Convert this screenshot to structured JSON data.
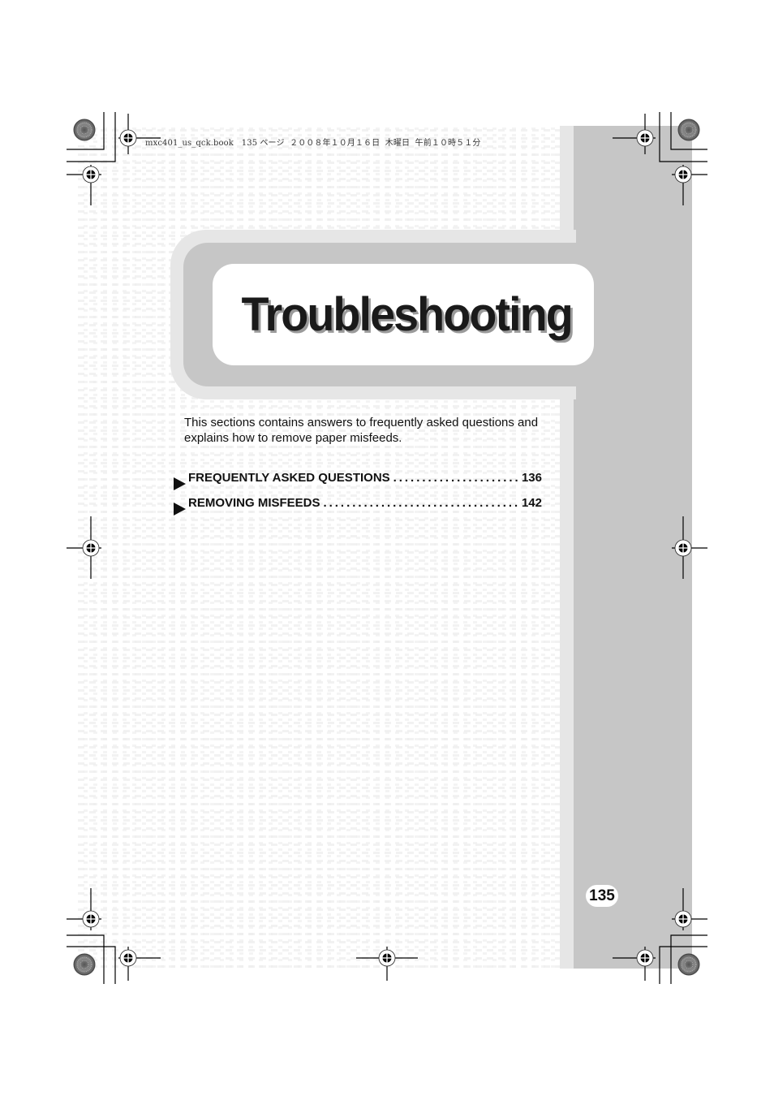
{
  "print_header": {
    "file_name": "mxc401_us_qck.book",
    "page_ref": "135 ページ",
    "date": "２００８年１０月１６日",
    "weekday": "木曜日",
    "time": "午前１０時５１分"
  },
  "chapter": {
    "title": "Troubleshooting",
    "intro": "This sections contains answers to frequently asked questions and explains how to remove paper misfeeds."
  },
  "toc": {
    "entries": [
      {
        "icon": "triangle-right-icon",
        "label": "FREQUENTLY ASKED QUESTIONS",
        "page": "136"
      },
      {
        "icon": "triangle-right-icon",
        "label": "REMOVING MISFEEDS",
        "page": "142"
      }
    ]
  },
  "footer": {
    "page_number": "135"
  },
  "colors": {
    "sidebar": "#c6c6c6",
    "sidebar_edge": "#e6e6e6",
    "title_text": "#1a1a1a",
    "title_shadow": "#9a9a9a"
  }
}
